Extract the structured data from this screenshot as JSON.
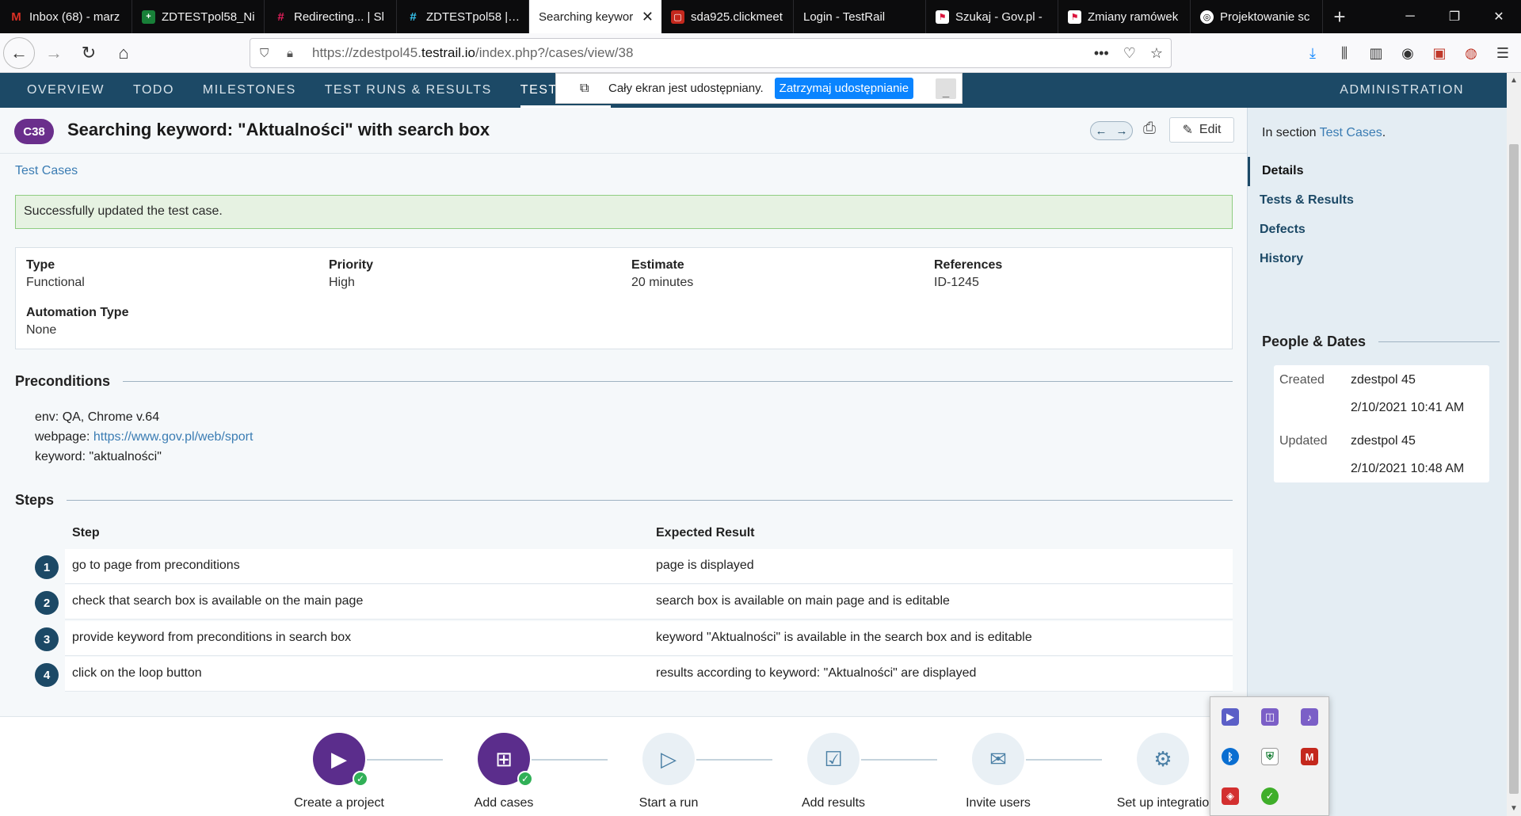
{
  "browser": {
    "tabs": [
      {
        "label": "Inbox (68) - marz",
        "icon_color": "#d93025",
        "glyph": "M"
      },
      {
        "label": "ZDTESTpol58_Ni",
        "icon_color": "#188038",
        "glyph": "+"
      },
      {
        "label": "Redirecting... | Sl",
        "icon_color": "#4a154b",
        "glyph": "#"
      },
      {
        "label": "ZDTESTpol58 | Sl",
        "icon_color": "#4a154b",
        "glyph": "#"
      },
      {
        "label": "Searching keywor",
        "icon_color": "",
        "glyph": ""
      },
      {
        "label": "sda925.clickmeet",
        "icon_color": "#c4281d",
        "glyph": "▢"
      },
      {
        "label": "Login - TestRail",
        "icon_color": "",
        "glyph": ""
      },
      {
        "label": "Szukaj - Gov.pl -",
        "icon_color": "#dc143c",
        "glyph": "⚑"
      },
      {
        "label": "Zmiany ramówek",
        "icon_color": "#dc143c",
        "glyph": "⚑"
      },
      {
        "label": "Projektowanie sc",
        "icon_color": "#333333",
        "glyph": "◎"
      }
    ],
    "url_prefix": "https://zdestpol45.",
    "url_domain": "testrail.io",
    "url_path": "/index.php?/cases/view/38"
  },
  "nav": {
    "items": [
      "OVERVIEW",
      "TODO",
      "MILESTONES",
      "TEST RUNS & RESULTS",
      "TEST CASES"
    ],
    "admin": "ADMINISTRATION"
  },
  "share": {
    "text": "Cały ekran jest udostępniany.",
    "button": "Zatrzymaj udostępnianie"
  },
  "case": {
    "id": "C38",
    "title": "Searching keyword: \"Aktualności\" with search box",
    "edit": "Edit",
    "breadcrumb": "Test Cases",
    "success": "Successfully updated the test case.",
    "props": {
      "type_label": "Type",
      "type_value": "Functional",
      "priority_label": "Priority",
      "priority_value": "High",
      "estimate_label": "Estimate",
      "estimate_value": "20 minutes",
      "refs_label": "References",
      "refs_value": "ID-1245",
      "auto_label": "Automation Type",
      "auto_value": "None"
    },
    "preconditions_title": "Preconditions",
    "preconditions": {
      "env": "env: QA, Chrome v.64",
      "webpage_label": "webpage: ",
      "webpage_link": "https://www.gov.pl/web/sport",
      "keyword": "keyword: \"aktualności\""
    },
    "steps_title": "Steps",
    "steps_head": {
      "step": "Step",
      "expected": "Expected Result"
    },
    "steps": [
      {
        "n": "1",
        "step": "go to page from preconditions",
        "expected": "page is displayed"
      },
      {
        "n": "2",
        "step": "check that search box is available on the main page",
        "expected": "search box is available on main page and is editable"
      },
      {
        "n": "3",
        "step": "provide keyword from preconditions in search box",
        "expected": "keyword \"Aktualności\" is available in the search box and is editable"
      },
      {
        "n": "4",
        "step": "click on the loop button",
        "expected": "results according to keyword: \"Aktualności\" are displayed"
      }
    ]
  },
  "onboarding": [
    {
      "label": "Create a project",
      "done": true
    },
    {
      "label": "Add cases",
      "done": true
    },
    {
      "label": "Start a run",
      "done": false
    },
    {
      "label": "Add results",
      "done": false
    },
    {
      "label": "Invite users",
      "done": false
    },
    {
      "label": "Set up integratio",
      "done": false
    }
  ],
  "sidebar": {
    "in_section": "In section ",
    "section_link": "Test Cases",
    "section_dot": ".",
    "nav": [
      "Details",
      "Tests & Results",
      "Defects",
      "History"
    ],
    "people_title": "People & Dates",
    "created_label": "Created",
    "created_by": "zdestpol 45",
    "created_at": "2/10/2021 10:41 AM",
    "updated_label": "Updated",
    "updated_by": "zdestpol 45",
    "updated_at": "2/10/2021 10:48 AM"
  },
  "colors": {
    "nav_bg": "#1c4966",
    "badge": "#6a2f8c",
    "link": "#3a7cb3",
    "success_bg": "#e6f2e2"
  }
}
